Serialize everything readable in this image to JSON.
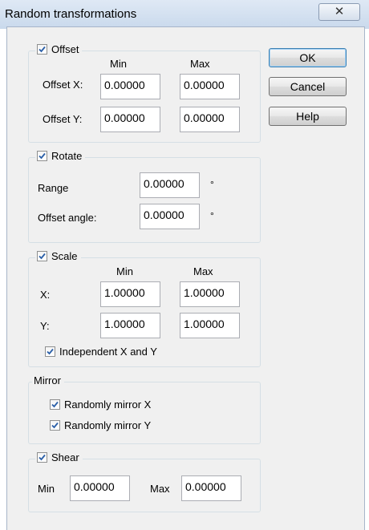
{
  "window": {
    "title": "Random transformations",
    "close_symbol": "✕"
  },
  "buttons": {
    "ok": "OK",
    "cancel": "Cancel",
    "help": "Help"
  },
  "offset": {
    "label": "Offset",
    "checked": true,
    "col_min": "Min",
    "col_max": "Max",
    "x_label": "Offset X:",
    "x_min": "0.00000",
    "x_max": "0.00000",
    "y_label": "Offset Y:",
    "y_min": "0.00000",
    "y_max": "0.00000"
  },
  "rotate": {
    "label": "Rotate",
    "checked": true,
    "range_label": "Range",
    "range_value": "0.00000",
    "angle_label": "Offset angle:",
    "angle_value": "0.00000",
    "degree_symbol": "°"
  },
  "scale": {
    "label": "Scale",
    "checked": true,
    "col_min": "Min",
    "col_max": "Max",
    "x_label": "X:",
    "x_min": "1.00000",
    "x_max": "1.00000",
    "y_label": "Y:",
    "y_min": "1.00000",
    "y_max": "1.00000",
    "independent_label": "Independent X and Y",
    "independent_checked": true
  },
  "mirror": {
    "label": "Mirror",
    "x_label": "Randomly mirror X",
    "x_checked": true,
    "y_label": "Randomly mirror Y",
    "y_checked": true
  },
  "shear": {
    "label": "Shear",
    "checked": true,
    "min_label": "Min",
    "min_value": "0.00000",
    "max_label": "Max",
    "max_value": "0.00000"
  }
}
